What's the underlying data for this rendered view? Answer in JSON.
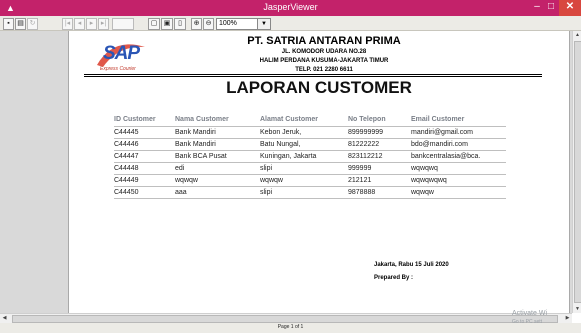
{
  "window": {
    "title": "JasperViewer"
  },
  "toolbar": {
    "zoom_value": "100%"
  },
  "company": {
    "name": "PT. SATRIA ANTARAN PRIMA",
    "address_line1": "JL. KOMODOR UDARA NO.28",
    "address_line2": "HALIM PERDANA KUSUMA-JAKARTA TIMUR",
    "phone": "TELP. 021 2280 6611",
    "logo_text": "SAP",
    "logo_subtext": "Express Courier"
  },
  "report": {
    "title": "LAPORAN CUSTOMER",
    "columns": [
      "ID Customer",
      "Nama Customer",
      "Alamat Customer",
      "No Telepon",
      "Email Customer"
    ],
    "rows": [
      [
        "C44445",
        "Bank Mandiri",
        "Kebon Jeruk,",
        "899999999",
        "mandiri@gmail.com"
      ],
      [
        "C44446",
        "Bank Mandiri",
        "Batu Nungal,",
        "81222222",
        "bdo@mandiri.com"
      ],
      [
        "C44447",
        "Bank BCA Pusat",
        "Kuningan, Jakarta",
        "823112212",
        "bankcentralasia@bca."
      ],
      [
        "C44448",
        "edi",
        "slipi",
        "999999",
        "wqwqwq"
      ],
      [
        "C44449",
        "wqwqw",
        "wqwqw",
        "212121",
        "wqwqwqwq"
      ],
      [
        "C44450",
        "aaa",
        "slipi",
        "9878888",
        "wqwqw"
      ]
    ],
    "date_text": "Jakarta, Rabu 15 Juli 2020",
    "prepared_by": "Prepared By :"
  },
  "status": {
    "page_info": "Page 1 of 1"
  },
  "watermark": {
    "line1": "Activate Wi",
    "line2": "Go to PC sett"
  },
  "colors": {
    "titlebar": "#c3226a",
    "close_button": "#d8473f",
    "logo_blue": "#2a55b5",
    "logo_red": "#c0392b"
  }
}
